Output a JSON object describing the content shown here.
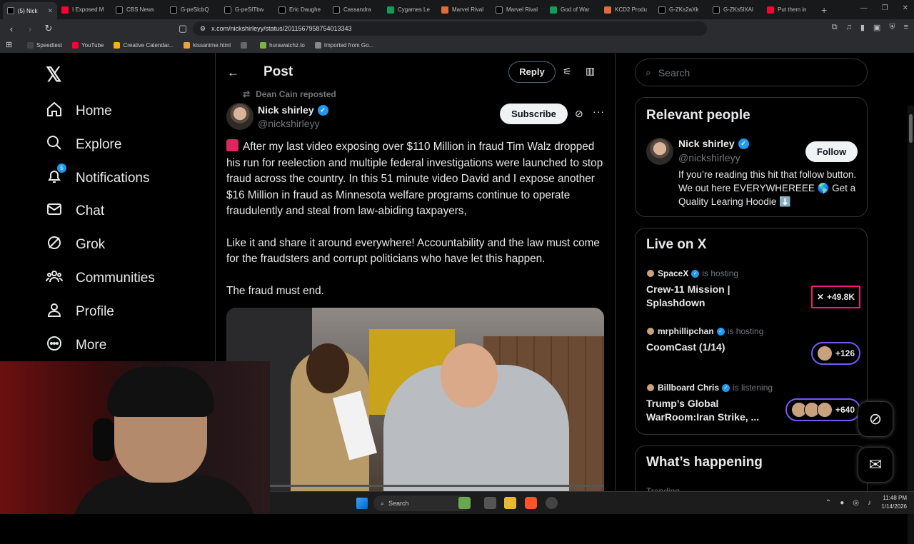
{
  "browser": {
    "tabs": [
      {
        "title": "(5) Nick",
        "color": "#000000",
        "active": true
      },
      {
        "title": "I Exposed M",
        "color": "#ff0033"
      },
      {
        "title": "CBS News",
        "color": "#000000"
      },
      {
        "title": "G-peSlcbQ",
        "color": "#000000"
      },
      {
        "title": "G-peSITbw",
        "color": "#000000"
      },
      {
        "title": "Eric Daughe",
        "color": "#000000"
      },
      {
        "title": "Cassandra",
        "color": "#000000"
      },
      {
        "title": "Cygames Le",
        "color": "#0f9d58"
      },
      {
        "title": "Marvel Rival",
        "color": "#e06c3c"
      },
      {
        "title": "Marvel Rival",
        "color": "#000000"
      },
      {
        "title": "God of War",
        "color": "#0f9d58"
      },
      {
        "title": "KCD2 Produ",
        "color": "#e06c3c"
      },
      {
        "title": "G-ZKs2aXk",
        "color": "#000000"
      },
      {
        "title": "G-ZKs5lXAl",
        "color": "#000000"
      },
      {
        "title": "Put them in",
        "color": "#ff0033"
      }
    ],
    "url": "x.com/nickshirleyy/status/2011567958754013343",
    "bookmarks": [
      {
        "label": "Speedtest",
        "color": "#444"
      },
      {
        "label": "YouTube",
        "color": "#ff0033"
      },
      {
        "label": "Creative Calendar...",
        "color": "#f4b400"
      },
      {
        "label": "kissanime.html",
        "color": "#e8a33c"
      },
      {
        "label": "",
        "color": "#666"
      },
      {
        "label": "hurawatchz.to",
        "color": "#7cb342"
      },
      {
        "label": "Imported from Go...",
        "color": "#888"
      }
    ]
  },
  "nav": {
    "items": [
      {
        "label": "Home",
        "icon": "home-icon"
      },
      {
        "label": "Explore",
        "icon": "search-icon"
      },
      {
        "label": "Notifications",
        "icon": "bell-icon",
        "badge": "5"
      },
      {
        "label": "Chat",
        "icon": "mail-icon"
      },
      {
        "label": "Grok",
        "icon": "grok-icon"
      },
      {
        "label": "Communities",
        "icon": "communities-icon"
      },
      {
        "label": "Profile",
        "icon": "profile-icon"
      },
      {
        "label": "More",
        "icon": "more-circle-icon"
      }
    ]
  },
  "header": {
    "title": "Post",
    "reply_label": "Reply"
  },
  "post": {
    "reposted_by": "Dean Cain reposted",
    "author_name": "Nick shirley",
    "author_handle": "@nickshirleyy",
    "subscribe_label": "Subscribe",
    "paragraphs": [
      "After my last video exposing over $110 Million in fraud Tim Walz dropped his run for reelection and multiple federal investigations were launched to stop  fraud across the country. In this 51 minute video David and I expose another $16 Million in fraud as Minnesota welfare programs continue to operate fraudulently and steal from law-abiding taxpayers,",
      "Like it and share it around everywhere! Accountability and the law must come for the fraudsters and corrupt politicians who have let this happen.",
      "The fraud must end."
    ]
  },
  "sidebar": {
    "search_placeholder": "Search",
    "relevant": {
      "title": "Relevant people",
      "name": "Nick shirley",
      "handle": "@nickshirleyy",
      "follow_label": "Follow",
      "bio": "If you’re reading this hit that follow button. We out here EVERYWHEREEE 🌎 Get a Quality Learing Hoodie ⬇️"
    },
    "live": {
      "title": "Live on X",
      "items": [
        {
          "host": "SpaceX",
          "action": "is hosting",
          "title": "Crew-11 Mission | Splashdown",
          "count": "+49.8K"
        },
        {
          "host": "mrphillipchan",
          "action": "is hosting",
          "title": "CoomCast (1/14)",
          "count": "+126"
        },
        {
          "host": "Billboard Chris",
          "action": "is listening",
          "title": "Trump’s Global WarRoom:Iran Strike, ...",
          "count": "+640"
        }
      ]
    },
    "happening_title": "What’s happening",
    "trending_label": "Trending"
  },
  "taskbar": {
    "search_label": "Search",
    "time": "11:48 PM",
    "date": "1/14/2026"
  }
}
